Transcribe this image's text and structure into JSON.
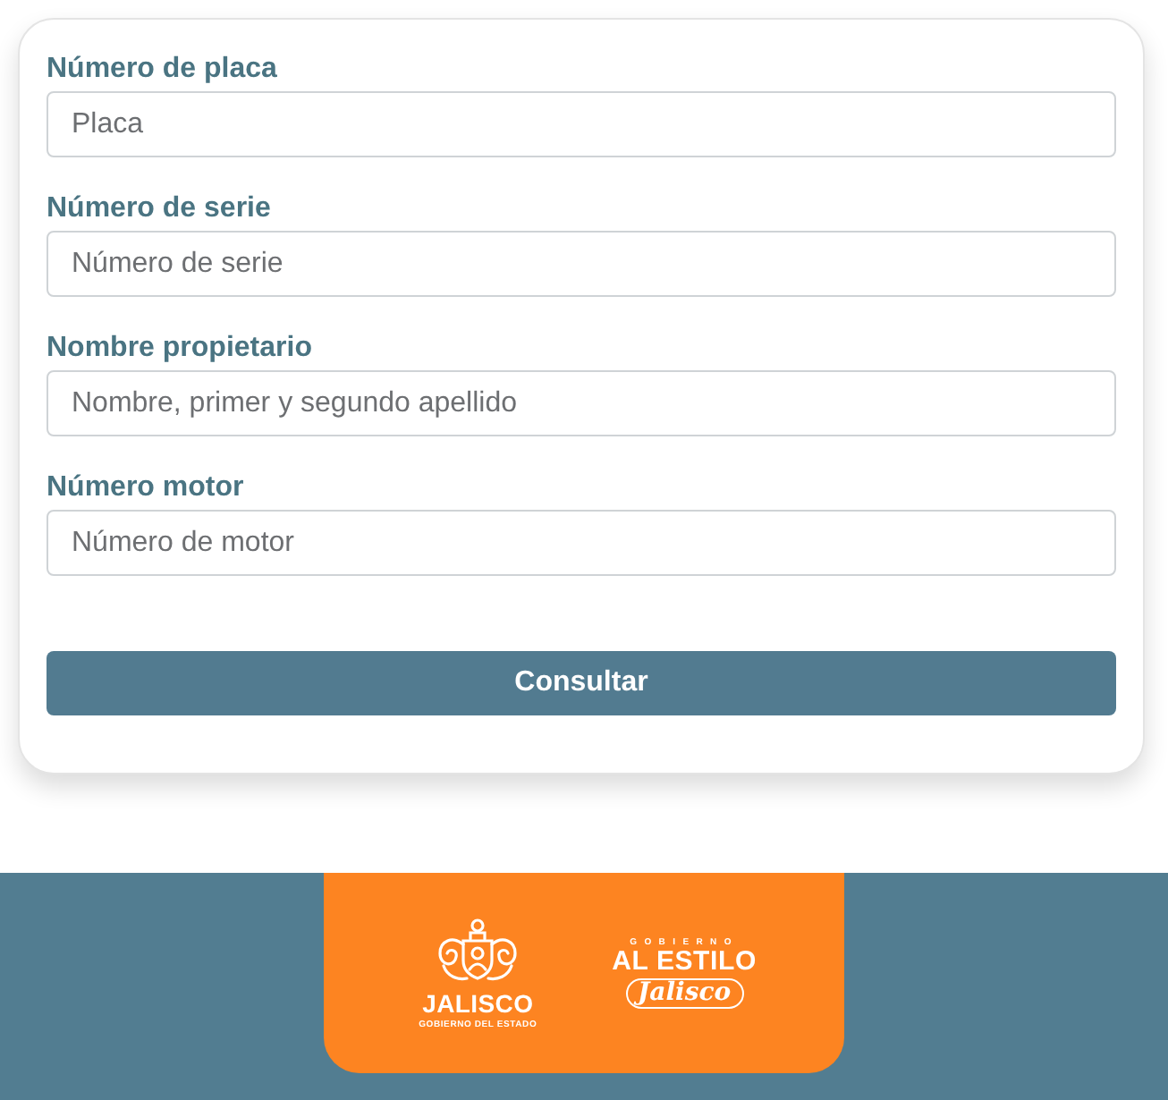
{
  "form": {
    "fields": [
      {
        "label": "Número de placa",
        "placeholder": "Placa"
      },
      {
        "label": "Número de serie",
        "placeholder": "Número de serie"
      },
      {
        "label": "Nombre propietario",
        "placeholder": "Nombre, primer y segundo apellido"
      },
      {
        "label": "Número motor",
        "placeholder": "Número de motor"
      }
    ],
    "submit": {
      "label": "Consultar"
    }
  },
  "footer": {
    "logos": [
      {
        "kind": "seal",
        "title": "JALISCO",
        "subtitle": "GOBIERNO DEL ESTADO"
      },
      {
        "kind": "wordmark",
        "overline": "GOBIERNO",
        "title": "AL ESTILO",
        "script": "Jalisco"
      }
    ]
  }
}
